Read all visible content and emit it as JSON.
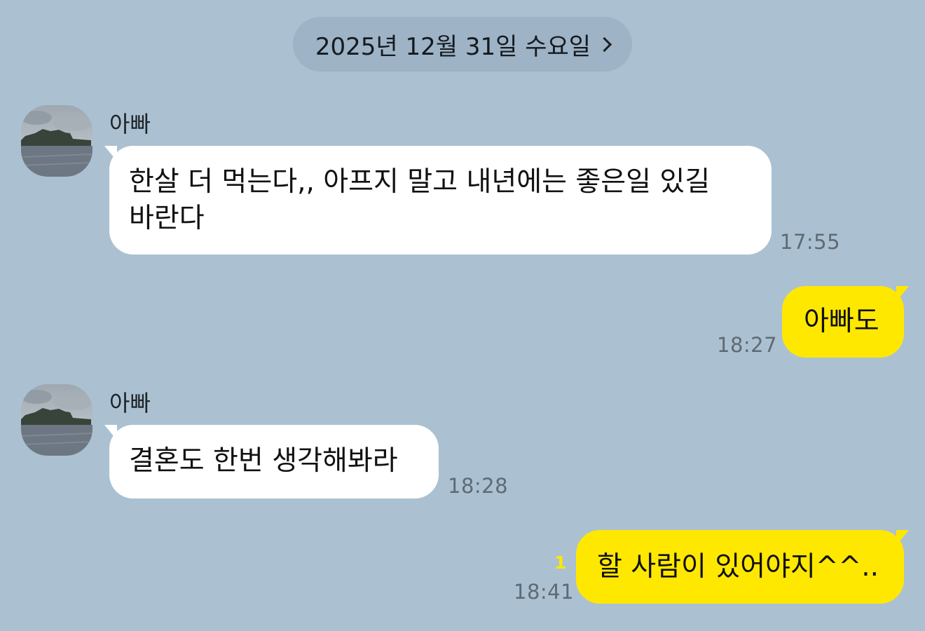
{
  "date_header": {
    "label": "2025년 12월 31일 수요일"
  },
  "messages": [
    {
      "sender": "아빠",
      "text_line_1": "한살 더 먹는다,, 아프지 말고 내년에는 좋은일 있길",
      "text_line_2": "바란다",
      "time": "17:55"
    },
    {
      "text": "아빠도",
      "time": "18:27"
    },
    {
      "sender": "아빠",
      "text": "결혼도 한번 생각해봐라",
      "time": "18:28"
    },
    {
      "text": "할 사람이 있어야지^^..",
      "time": "18:41",
      "unread_count": "1"
    }
  ]
}
